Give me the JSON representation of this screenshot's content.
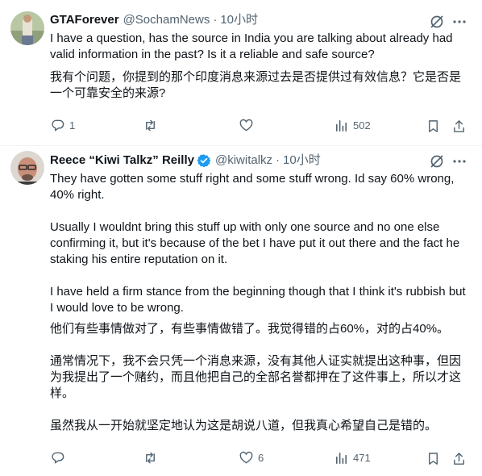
{
  "tweets": [
    {
      "name": "GTAForever",
      "handle": "@SochamNews",
      "dot": "·",
      "time": "10小时",
      "text_en": "I have a question, has the source in India you are talking about already had valid information in the past? Is it a reliable and safe source?",
      "text_zh": "我有个问题，你提到的那个印度消息来源过去是否提供过有效信息？它是否是一个可靠安全的来源?",
      "replies": "1",
      "retweets": "",
      "likes": "",
      "views": "502"
    },
    {
      "name": "Reece “Kiwi Talkz” Reilly",
      "handle": "@kiwitalkz",
      "dot": "·",
      "time": "10小时",
      "verified": true,
      "text_en_1": "They have gotten some stuff right and some stuff wrong. Id say 60% wrong, 40% right.",
      "text_en_2": "Usually I wouldnt bring this stuff up with only one source and no one else confirming it, but it's because of the bet I have put it out there and the fact he staking his entire reputation on it.",
      "text_en_3": "I have held a firm stance from the beginning though that I think it's rubbish but I would love to be wrong.",
      "text_zh_1": "他们有些事情做对了，有些事情做错了。我觉得错的占60%，对的占40%。",
      "text_zh_2": "通常情况下，我不会只凭一个消息来源，没有其他人证实就提出这种事，但因为我提出了一个赌约，而且他把自己的全部名誉都押在了这件事上，所以才这样。",
      "text_zh_3": "虽然我从一开始就坚定地认为这是胡说八道，但我真心希望自己是错的。",
      "replies": "",
      "retweets": "",
      "likes": "6",
      "views": "471"
    }
  ],
  "colors": {
    "text": "#0f1419",
    "secondary": "#536471",
    "verified": "#1d9bf0",
    "divider": "#eff3f4"
  }
}
